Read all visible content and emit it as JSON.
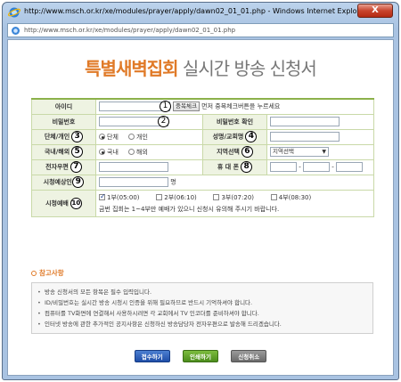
{
  "window": {
    "title": "http://www.msch.or.kr/xe/modules/prayer/apply/dawn02_01_01.php - Windows Internet Explorer",
    "address": "http://www.msch.or.kr/xe/modules/prayer/apply/dawn02_01_01.php",
    "close_label": "X"
  },
  "header": {
    "title_accent": "특별새벽집회",
    "title_rest": " 실시간 방송 신청서"
  },
  "form": {
    "id_label": "아이디",
    "dup_check_button": "중복체크",
    "dup_check_hint": "먼저 중복체크버튼을 누르세요",
    "password_label": "비밀번호",
    "password_confirm_label": "비밀번호 확인",
    "group_label": "단체/개인",
    "group_options": [
      "단체",
      "개인"
    ],
    "group_selected": "단체",
    "name_church_label": "성명/교회명",
    "region_label": "국내/해외",
    "region_options": [
      "국내",
      "해외"
    ],
    "region_selected": "국내",
    "area_label": "지역선택",
    "area_select_value": "지역선택",
    "phone_label": "전자우편",
    "mobile_label": "휴 대 폰",
    "dash": "-",
    "viewers_label": "시청예상인원",
    "viewers_unit": "명",
    "schedule_label": "시청예배",
    "schedule_options": [
      "1부(05:00)",
      "2부(06:10)",
      "3부(07:20)",
      "4부(08:30)"
    ],
    "schedule_checked": [
      true,
      false,
      false,
      false
    ],
    "schedule_note": "금번 집회는 1~4부만 예배가 있으니 신청시 유의해 주시기 바랍니다.",
    "markers": [
      "1",
      "2",
      "3",
      "4",
      "5",
      "6",
      "7",
      "8",
      "9",
      "10"
    ]
  },
  "reference": {
    "title": "참고사항",
    "bullet": "•",
    "items": [
      "방송 신청서의 모든 항목은 필수 입력입니다.",
      "ID/비밀번호는 실시간 방송 시청시 인증을 위해 필요하므로 반드시 기억하셔야 합니다.",
      "컴퓨터를 TV화면에 연결해서 사용하시려면 각 교회에서 TV 인코더를 준비하셔야 합니다.",
      "인터넷 방송에 관한 추가적인 공지사항은 신청하신 방송담당자 전자우편으로 발송해 드리겠습니다."
    ]
  },
  "actions": {
    "submit": "접수하기",
    "print": "인쇄하기",
    "cancel": "신청취소"
  },
  "colors": {
    "accent": "#e07a28",
    "table_border": "#8cb14a",
    "label_bg": "#eef3e2"
  }
}
